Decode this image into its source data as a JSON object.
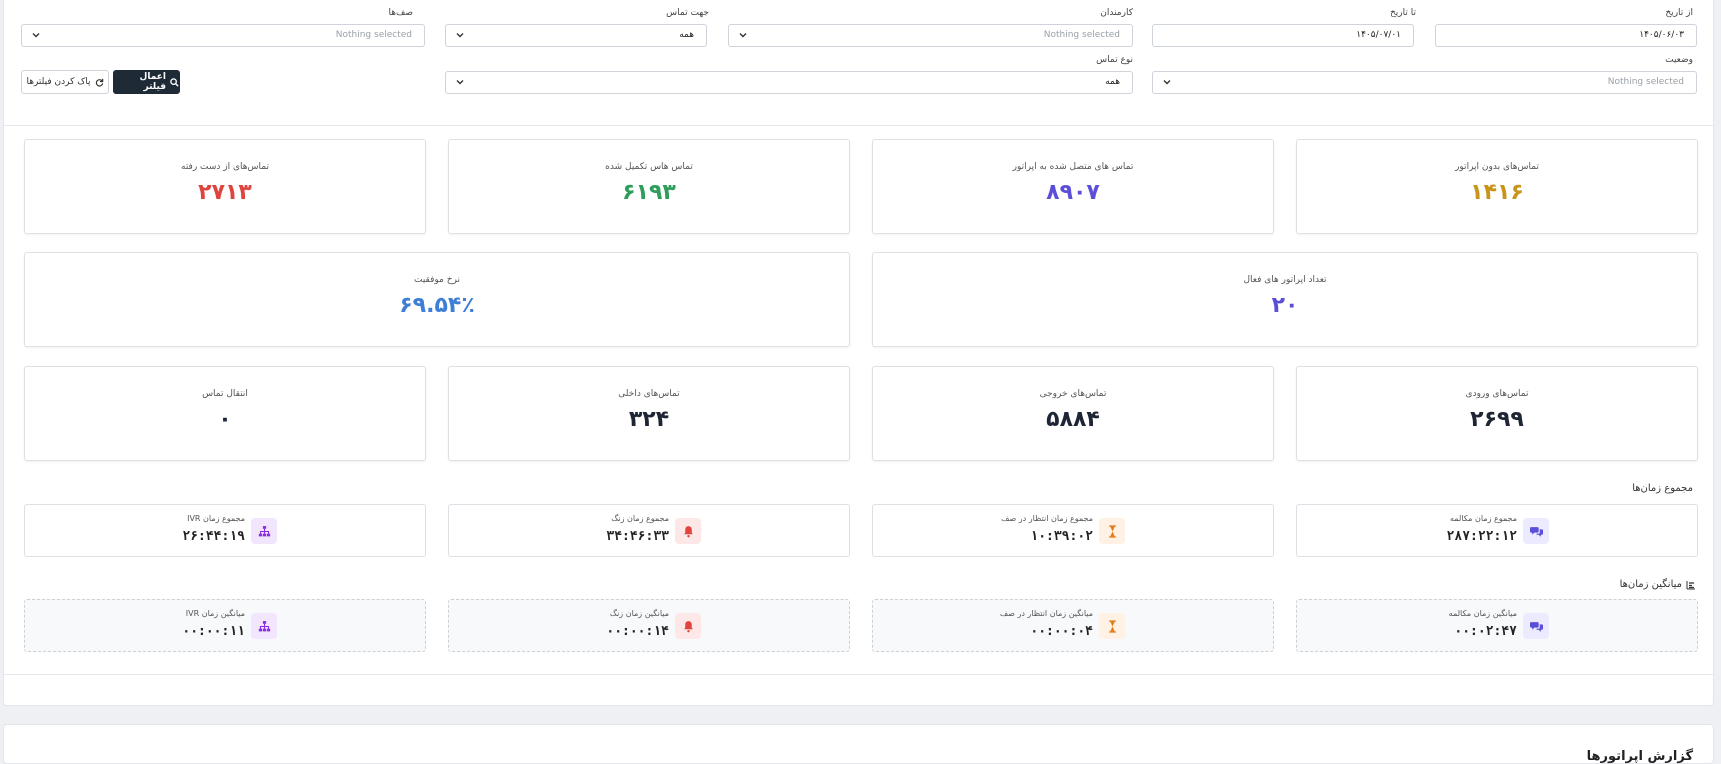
{
  "filters": {
    "from_date": {
      "label": "از تاریخ",
      "value": "۱۴۰۵/۰۶/۰۳"
    },
    "to_date": {
      "label": "تا تاریخ",
      "value": "۱۴۰۵/۰۷/۰۱"
    },
    "employees": {
      "label": "کارمندان",
      "value": "Nothing selected"
    },
    "direction": {
      "label": "جهت تماس",
      "value": "همه"
    },
    "queues": {
      "label": "صف‌ها",
      "value": "Nothing selected"
    },
    "status": {
      "label": "وضعیت",
      "value": "Nothing selected"
    },
    "call_type": {
      "label": "نوع تماس",
      "value": "همه"
    },
    "apply_label": "اعمال فیلتر",
    "clear_label": "پاک کردن فیلترها"
  },
  "stats_row1": [
    {
      "title": "تماس‌های بدون اپراتور",
      "value": "۱۴۱۶",
      "color": "#c9941a"
    },
    {
      "title": "تماس های متصل شده به اپراتور",
      "value": "۸۹۰۷",
      "color": "#5b4fd9"
    },
    {
      "title": "تماس هاس تکمیل شده",
      "value": "۶۱۹۳",
      "color": "#2e9e5b"
    },
    {
      "title": "تماس‌های از دست رفته",
      "value": "۲۷۱۳",
      "color": "#e0443e"
    }
  ],
  "stats_row2": [
    {
      "title": "تعداد اپراتور های فعال",
      "value": "۲۰",
      "color": "#5b4fd9"
    },
    {
      "title": "نرخ موفقیت",
      "value": "۶۹.۵۴٪",
      "color": "#3d7fd6"
    }
  ],
  "stats_row3": [
    {
      "title": "تماس‌های ورودی",
      "value": "۲۶۹۹",
      "color": "#1e2636"
    },
    {
      "title": "تماس‌های خروجی",
      "value": "۵۸۸۴",
      "color": "#1e2636"
    },
    {
      "title": "تماس‌های داخلی",
      "value": "۳۲۴",
      "color": "#1e2636"
    },
    {
      "title": "انتقال تماس",
      "value": "۰",
      "color": "#1e2636"
    }
  ],
  "totals": {
    "title": "مجموع زمان‌ها",
    "items": [
      {
        "label": "مجموع زمان مکالمه",
        "value": "۲۸۷:۲۲:۱۲",
        "icon": "chat-icon"
      },
      {
        "label": "مجموع زمان انتظار در صف",
        "value": "۱۰:۳۹:۰۲",
        "icon": "hourglass-icon"
      },
      {
        "label": "مجموع زمان زنگ",
        "value": "۳۴:۴۶:۳۳",
        "icon": "bell-icon"
      },
      {
        "label": "مجموع زمان IVR",
        "value": "۲۶:۴۴:۱۹",
        "icon": "sitemap-icon"
      }
    ]
  },
  "averages": {
    "title": "میانگین زمان‌ها",
    "items": [
      {
        "label": "میانگین زمان مکالمه",
        "value": "۰۰:۰۲:۴۷",
        "icon": "chat-icon"
      },
      {
        "label": "میانگین زمان انتظار در صف",
        "value": "۰۰:۰۰:۰۴",
        "icon": "hourglass-icon"
      },
      {
        "label": "میانگین زمان زنگ",
        "value": "۰۰:۰۰:۱۴",
        "icon": "bell-icon"
      },
      {
        "label": "میانگین زمان IVR",
        "value": "۰۰:۰۰:۱۱",
        "icon": "sitemap-icon"
      }
    ]
  },
  "section2_title": "گزارش اپراتورها"
}
